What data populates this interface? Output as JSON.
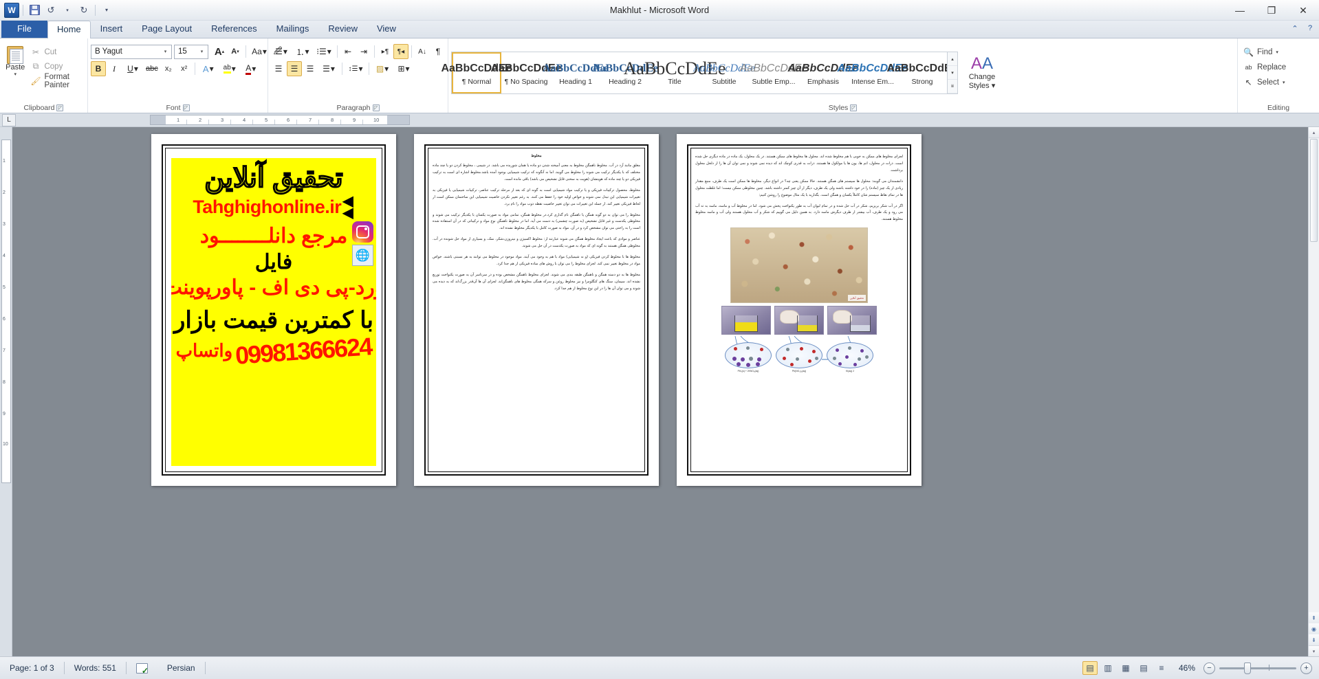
{
  "window": {
    "title": "Makhlut  -  Microsoft Word",
    "app_icon": "word-logo-icon",
    "minimize": "—",
    "maximize": "❐",
    "close": "✕"
  },
  "quick_access": {
    "save": "save-icon",
    "undo": "↺",
    "undo_more": "▾",
    "redo": "↻",
    "customize": "▾"
  },
  "tabs": [
    {
      "label": "File",
      "id": "file",
      "active": false
    },
    {
      "label": "Home",
      "id": "home",
      "active": true
    },
    {
      "label": "Insert",
      "id": "insert",
      "active": false
    },
    {
      "label": "Page Layout",
      "id": "page-layout",
      "active": false
    },
    {
      "label": "References",
      "id": "references",
      "active": false
    },
    {
      "label": "Mailings",
      "id": "mailings",
      "active": false
    },
    {
      "label": "Review",
      "id": "review",
      "active": false
    },
    {
      "label": "View",
      "id": "view",
      "active": false
    }
  ],
  "help_bar": {
    "collapse_ribbon": "⌃",
    "help": "?"
  },
  "ribbon": {
    "clipboard": {
      "label": "Clipboard",
      "paste": "Paste",
      "paste_arrow": "▾",
      "cut": "Cut",
      "copy": "Copy",
      "format_painter": "Format Painter"
    },
    "font": {
      "label": "Font",
      "font_name": "B Yagut",
      "font_size": "15",
      "grow_font": "A",
      "shrink_font": "A",
      "change_case": "Aa",
      "clear_formatting": "⌫",
      "bold": "B",
      "italic": "I",
      "underline": "U",
      "strikethrough": "abc",
      "subscript": "x₂",
      "superscript": "x²",
      "text_effects": "A",
      "highlight": "ab",
      "font_color": "A"
    },
    "paragraph": {
      "label": "Paragraph",
      "bullets": "☰",
      "numbering": "⒈",
      "multilevel": "⁝☰",
      "decrease_indent": "⇤",
      "increase_indent": "⇥",
      "ltr_text": "▸¶",
      "rtl_text": "¶◂",
      "sort": "A↓",
      "show_marks": "¶",
      "align_left": "☰",
      "align_center": "☰",
      "align_right": "☰",
      "justify": "☰",
      "line_spacing": "↕☰",
      "shading": "▨",
      "borders": "⊞"
    },
    "styles": {
      "label": "Styles",
      "items": [
        {
          "preview": "AaBbCcDdEe",
          "name": "¶ Normal",
          "selected": true
        },
        {
          "preview": "AaBbCcDdEe",
          "name": "¶ No Spacing",
          "selected": false
        },
        {
          "preview": "AaBbCcDdEe",
          "name": "Heading 1",
          "selected": false
        },
        {
          "preview": "AaBbCcDdEe",
          "name": "Heading 2",
          "selected": false
        },
        {
          "preview": "AaBbCcDdEe",
          "name": "Title",
          "selected": false
        },
        {
          "preview": "AaBbCcDdEe",
          "name": "Subtitle",
          "selected": false
        },
        {
          "preview": "AaBbCcDdEe",
          "name": "Subtle Emp...",
          "selected": false
        },
        {
          "preview": "AaBbCcDdEe",
          "name": "Emphasis",
          "selected": false
        },
        {
          "preview": "AaBbCcDdEe",
          "name": "Intense Em...",
          "selected": false
        },
        {
          "preview": "AaBbCcDdEe",
          "name": "Strong",
          "selected": false
        }
      ],
      "scroll_up": "▴",
      "scroll_down": "▾",
      "more": "▾",
      "change_styles": "Change",
      "change_styles_2": "Styles ▾"
    },
    "editing": {
      "label": "Editing",
      "find": "Find",
      "find_arrow": "▾",
      "replace": "Replace",
      "select": "Select",
      "select_arrow": "▾"
    }
  },
  "ruler": {
    "tab_selector": "L",
    "marks": [
      "1",
      "2",
      "3",
      "4",
      "5",
      "6",
      "7",
      "8",
      "9",
      "10"
    ]
  },
  "document": {
    "page1": {
      "title_fa": "تحقیق آنلاین",
      "url": "Tahghighonline.ir",
      "line_download": "مرجع دانلــــــــود",
      "line_file": "فایل",
      "line_formats": "ورد-پی دی اف - پاورپوینت",
      "line_price": "با کمترین قیمت بازار",
      "phone": "09981366624",
      "whatsapp": "واتساپ",
      "instagram_icon": "instagram-icon",
      "web_icon": "web-link-icon",
      "arrow1": "◀",
      "arrow2": "◀"
    },
    "page2": {
      "heading": "مخلوط",
      "paragraphs": [
        "مغلق مانند آرد در آب. مخلوط ناهمگن مخلوط به معنی آمیخته شدن دو ماده یا همان شوریده می باشد. در شیمی ، مخلوط کردن دو یا چند ماده مختلف که با یکدیگر ترکیب می شوند را مخلوط می گویند. اما نه آنگونه که ترکیب شیمیایی بوجود آمده باشد.مخلوط اشاره ای است به ترکیب فیزیکی دو یا چند ماده که هویتشان (هویت به سختی قابل تشخیص می باشد) باقی مانده است.",
        "مخلوط، محصول ترکیبات فیزیکی و یا ترکیب مواد شیمیایی است به گونه ای که بعد از مرحله ترکیب عناصر، ترکیبات شیمیایی یا فیزیکی به تغییرات شیمیایی این تبدل نمی شوند و خواص اولیه خود را حفظ می کنند. به رغم تغییر نکردن خاصیت شیمیایی این ساختمان ممکن است از لحاظ فیزیکی تغییر کند. از جمله این تغییرات می توان تغییر خاصیت نقطه ذوب مواد را نام برد.",
        "مخلوط را می توان به دو گونه همگن یا ناهمگن نام گذاری کرد.در مخلوط همگن، تمامی مواد به صورت یکسان با یکدیگر ترکیب می شوند و مخلوطی یکدست و غیر قابل تشخیص (به صورت چشمی) به دست می آید. اما در مخلوط ناهمگن نوع مواد و ترکیباتی که در آن استفاده شده است را به راحتی می توان مشخص کرد و در آن. مواد به صورت کامل با یکدیگر مخلوط نشده اند.",
        "عناصر و موادی که باعث ایجاد مخلوط همگن می شوند عبارتند از: مخلوط اکسیژن و نیتروژن،شکر، نمک، و بسیاری از مواد حل شونده در آب. مخلوطی همگن هستند به گونه ای که مواد به صورت یکدست در آن حل می شوند.",
        "مخلوط ها با مخلوط کردن فیزیکی (و نه شیمیایی) مواد با هم به وجود می آیند. مواد موجود در مخلوط می توانند به هر نسبتی باشند. خواص مواد در مخلوط تغییر نمی کند. لجزای مخلوط را می توان با روش های ساده فیزیکی از هم جدا کرد.",
        "مخلوط ها به دو دسته همگن و ناهمگن طبقه بندی می شوند. لجزای مخلوط ناهمگن مشخص بوده و در سرتاسر آن به صورت یکنواخت توزیع نشده اند. سیمان، سنگ های کنگلومرا و نیز مخلوط روغن و سرکه همگی مخلوط های ناهمگن‌اند. لجزای آن ها آن‌قدر بزرگ‌اند که به دیده می شوند و می توان آن ها را در این نوع مخلوط از هم جدا کرد."
      ]
    },
    "page3": {
      "paragraphs": [
        "لجزای مخلوط های ممکن به خوبی با هم مخلوط شده اند. محلول ها مخلوط های ممکن هستند. در یک محلول، یک ماده در ماده دیگری حل شده است. ذرات در محلول، اتم ها، یون ها یا مولکول ها هستند. ذرات به قدری کوچک اند که دیده نمی شوند و نمی توان آن ها را از دلخل محلول برداشت.",
        "دانشمندان می گویند: محلول ها سیستم های همگن هستند. حالا ممکن یعنی چه؟ در انواع دیگر، مخلوط ها ممکن است یک طرف، منبع مقدار زیادی از یک چیز (ماده) را در خود داشته باشند ولی یک طرف، دیگر از آن چیز کمتر داشته باشد. چنین مخلوطی ممکن نیست؛ اما غلظت محلول ها در تمام نقاط سیستم شان کاملاً یکسان و همگن است. بگذارید با یک مثال موضوع را روشن کنیم:",
        "اگر در آب شکر بریزیم، شکر در آب حل شده و در تمام لیوان آب به طور یکنواخت پخش می شود. اما در مخلوط آب و ماسه، ماسه به ته آب می رود و یک طرف، آب بیشتر از طرف دیگرش ماسه دارد. به همین دلیل می گوییم که شکر و آب محلول هستند ولی آب و ماسه مخلوط مخلوط هستند."
      ],
      "image_beans": "mixed-grains-photo",
      "image_beans_watermark": "تحقیق آنلاین",
      "diagram": {
        "caption_1": "2 KI(aq)",
        "caption_2": "Pb(NO₃)₂(aq)",
        "caption_3": "PbI₂(s) + 2KNO₃(aq)",
        "plus": "+",
        "arrow": "→"
      }
    }
  },
  "scrollbars": {
    "up": "▴",
    "down": "▾",
    "prev_page": "⇞",
    "select_browse": "◉",
    "next_page": "⇟",
    "left": "◂",
    "right": "▸"
  },
  "status_bar": {
    "page": "Page: 1 of 3",
    "words": "Words: 551",
    "proofing_icon": "spell-check-icon",
    "language": "Persian",
    "views": [
      {
        "name": "print-layout",
        "glyph": "▤",
        "active": true
      },
      {
        "name": "full-screen-reading",
        "glyph": "▥",
        "active": false
      },
      {
        "name": "web-layout",
        "glyph": "▦",
        "active": false
      },
      {
        "name": "outline",
        "glyph": "▤",
        "active": false
      },
      {
        "name": "draft",
        "glyph": "≡",
        "active": false
      }
    ],
    "zoom": "46%",
    "zoom_out": "−",
    "zoom_in": "+"
  },
  "colors": {
    "accent": "#2c5fa8",
    "ad_background": "#ffff00",
    "ad_red": "#ff1500",
    "selection": "#fbe6a2"
  }
}
